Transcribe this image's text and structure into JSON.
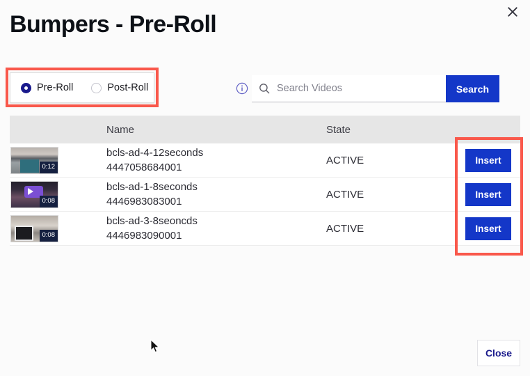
{
  "dialog": {
    "title": "Bumpers - Pre-Roll",
    "close_icon": "close-x-icon",
    "footer_close_label": "Close"
  },
  "roll_type": {
    "options": [
      {
        "label": "Pre-Roll",
        "selected": true
      },
      {
        "label": "Post-Roll",
        "selected": false
      }
    ]
  },
  "search": {
    "info_icon": "info-circle-icon",
    "search_icon": "magnifier-icon",
    "placeholder": "Search Videos",
    "value": "",
    "button_label": "Search"
  },
  "table": {
    "columns": [
      "",
      "Name",
      "State",
      ""
    ],
    "headers": {
      "thumbnail": "",
      "name": "Name",
      "state": "State",
      "action": ""
    },
    "rows": [
      {
        "duration": "0:12",
        "name": "bcls-ad-4-12seconds",
        "id": "4447058684001",
        "state": "ACTIVE",
        "action_label": "Insert"
      },
      {
        "duration": "0:08",
        "name": "bcls-ad-1-8seconds",
        "id": "4446983083001",
        "state": "ACTIVE",
        "action_label": "Insert"
      },
      {
        "duration": "0:08",
        "name": "bcls-ad-3-8seoncds",
        "id": "4446983090001",
        "state": "ACTIVE",
        "action_label": "Insert"
      }
    ]
  },
  "annotations": [
    {
      "name": "roll-type-highlight",
      "color": "#f9584b"
    },
    {
      "name": "insert-column-highlight",
      "color": "#f9584b"
    }
  ],
  "colors": {
    "primary_blue": "#1437c8",
    "radio_navy": "#1a1a8c",
    "highlight_red": "#f9584b",
    "header_gray": "#e6e6e6",
    "page_bg": "#fbfbfb"
  }
}
